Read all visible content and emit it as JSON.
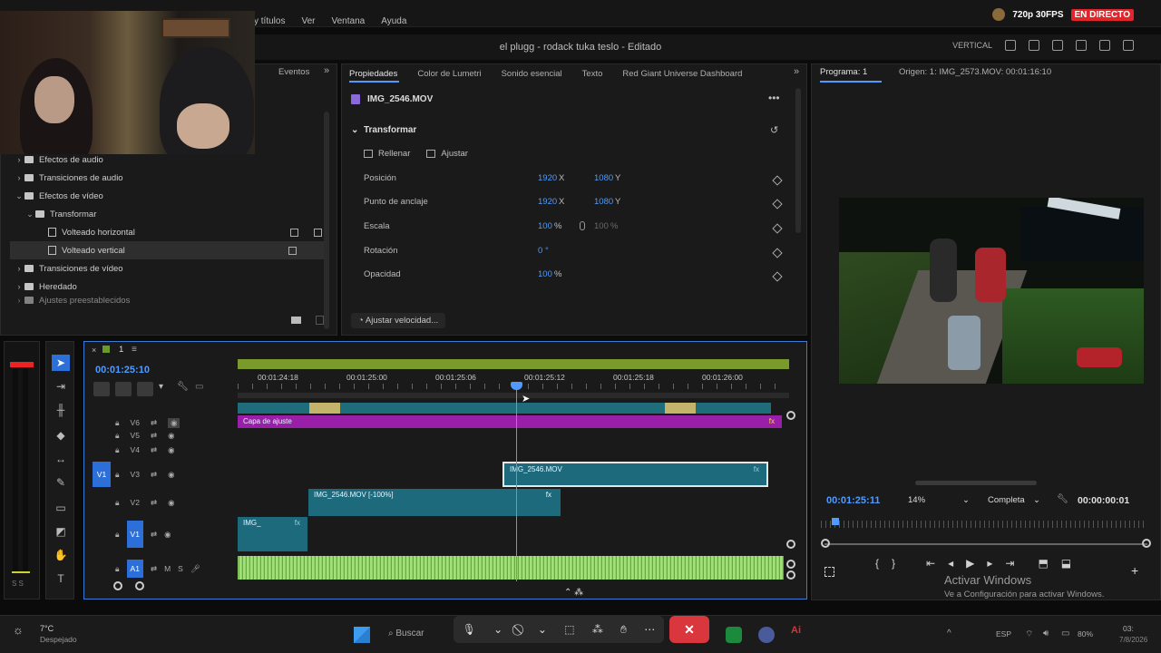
{
  "topbar": {
    "menu": [
      "y títulos",
      "Ver",
      "Ventana",
      "Ayuda"
    ],
    "stream_quality": "720p 30FPS",
    "live_badge": "EN DIRECTO"
  },
  "header": {
    "title": "el plugg - rodack tuka teslo - Editado",
    "workspace": "VERTICAL"
  },
  "effects_panel": {
    "tab_events": "Eventos",
    "items": [
      {
        "label": "Efectos de audio",
        "level": 0,
        "type": "folder"
      },
      {
        "label": "Transiciones de audio",
        "level": 0,
        "type": "folder"
      },
      {
        "label": "Efectos de vídeo",
        "level": 0,
        "type": "folder",
        "open": true
      },
      {
        "label": "Transformar",
        "level": 1,
        "type": "folder",
        "open": true
      },
      {
        "label": "Volteado horizontal",
        "level": 2,
        "type": "effect"
      },
      {
        "label": "Volteado vertical",
        "level": 2,
        "type": "effect",
        "selected": true
      },
      {
        "label": "Transiciones de vídeo",
        "level": 0,
        "type": "folder"
      },
      {
        "label": "Heredado",
        "level": 0,
        "type": "folder"
      },
      {
        "label": "Ajustes preestablecidos",
        "level": 0,
        "type": "folder"
      }
    ]
  },
  "properties_panel": {
    "tabs": [
      "Propiedades",
      "Color de Lumetri",
      "Sonido esencial",
      "Texto",
      "Red Giant Universe Dashboard"
    ],
    "clip_name": "IMG_2546.MOV",
    "section": "Transformar",
    "fill_label": "Rellenar",
    "fit_label": "Ajustar",
    "rows": [
      {
        "label": "Posición",
        "v1": "1920",
        "u1": "X",
        "v2": "1080",
        "u2": "Y"
      },
      {
        "label": "Punto de anclaje",
        "v1": "1920",
        "u1": "X",
        "v2": "1080",
        "u2": "Y"
      },
      {
        "label": "Escala",
        "v1": "100",
        "u1": "%",
        "v2": "100",
        "u2": "%"
      },
      {
        "label": "Rotación",
        "v1": "0",
        "u1": "°",
        "v2": "",
        "u2": ""
      },
      {
        "label": "Opacidad",
        "v1": "100",
        "u1": "%",
        "v2": "",
        "u2": ""
      }
    ],
    "speed_button": "Ajustar velocidad..."
  },
  "program_monitor": {
    "tab": "Programa: 1",
    "source": "Origen: 1: IMG_2573.MOV: 00:01:16:10",
    "timecode": "00:01:25:11",
    "zoom": "14%",
    "quality": "Completa",
    "duration": "00:00:00:01"
  },
  "timeline": {
    "sequence_name": "1",
    "timecode": "00:01:25:10",
    "ruler": [
      "00:01:24:18",
      "00:01:25:00",
      "00:01:25:06",
      "00:01:25:12",
      "00:01:25:18",
      "00:01:26:00"
    ],
    "tracks": {
      "v6": "V6",
      "v5": "V5",
      "v4": "V4",
      "v3": "V3",
      "v2": "V2",
      "v1": "V1",
      "a1": "A1",
      "v1_target": "V1",
      "mute": "M",
      "solo": "S"
    },
    "clips": {
      "adjust": "Capa de ajuste",
      "v3": "IMG_2546.MOV",
      "v2": "IMG_2546.MOV [-100%]",
      "v1": "IMG_",
      "fx": "fx"
    },
    "meter_label": "S S"
  },
  "windows": {
    "activate_title": "Activar Windows",
    "activate_sub": "Ve a Configuración para activar Windows.",
    "search": "Buscar",
    "weather_temp": "7°C",
    "weather_desc": "Despejado",
    "lang": "ESP",
    "battery": "80%",
    "time": "03:",
    "date": "7/8/2026"
  }
}
